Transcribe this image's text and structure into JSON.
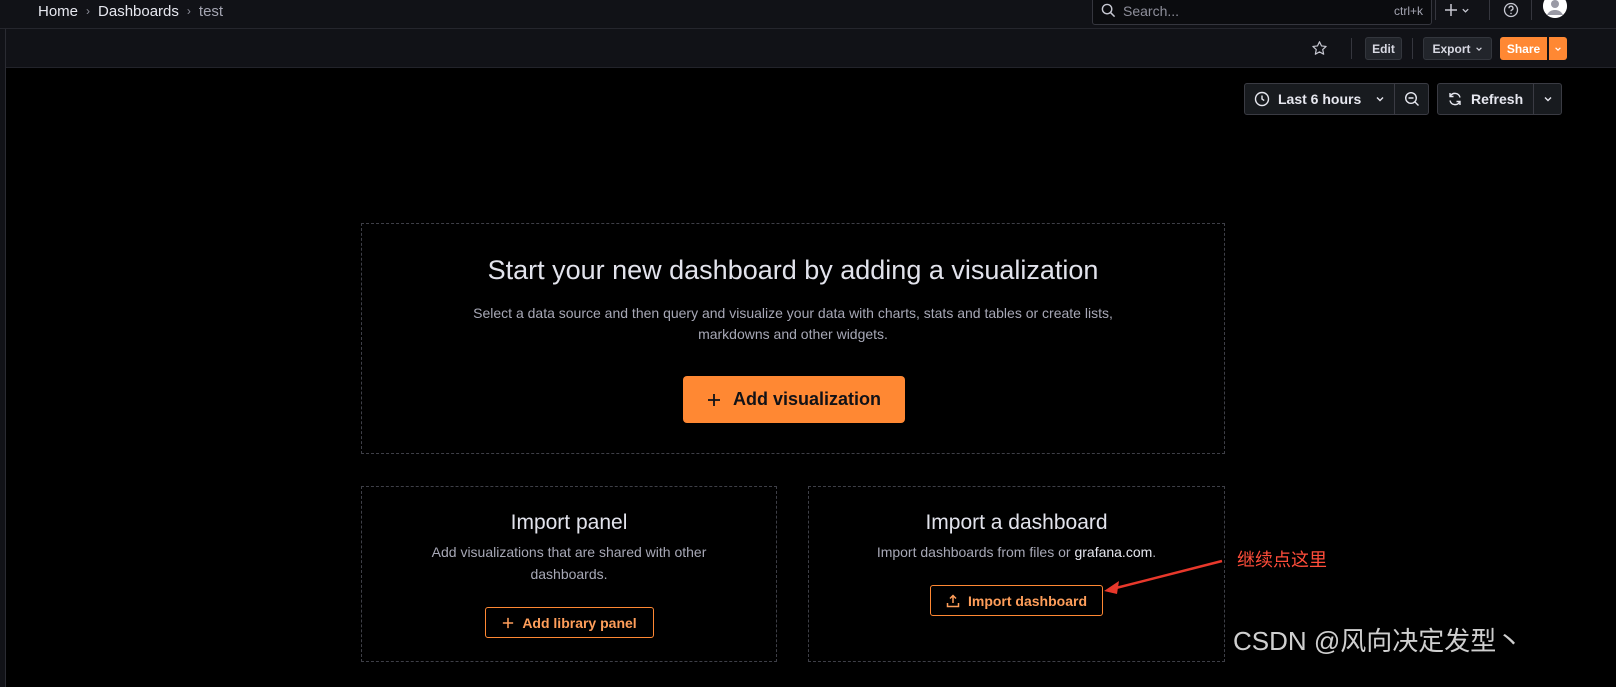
{
  "breadcrumb": {
    "items": [
      "Home",
      "Dashboards",
      "test"
    ]
  },
  "search": {
    "placeholder": "Search...",
    "shortcut": "ctrl+k"
  },
  "toolbar": {
    "edit_label": "Edit",
    "export_label": "Export",
    "share_label": "Share"
  },
  "time_controls": {
    "range_label": "Last 6 hours",
    "refresh_label": "Refresh"
  },
  "empty_state": {
    "title": "Start your new dashboard by adding a visualization",
    "description_line1": "Select a data source and then query and visualize your data with charts, stats and tables or create lists,",
    "description_line2": "markdowns and other widgets.",
    "add_visualization_label": "Add visualization"
  },
  "import_panel": {
    "title": "Import panel",
    "description_line1": "Add visualizations that are shared with other",
    "description_line2": "dashboards.",
    "button_label": "Add library panel"
  },
  "import_dashboard": {
    "title": "Import a dashboard",
    "description_prefix": "Import dashboards from files or",
    "description_link": "grafana.com",
    "description_suffix": ".",
    "button_label": "Import dashboard"
  },
  "annotation": {
    "note": "继续点这里"
  },
  "watermark": {
    "text": "CSDN @风向决定发型丶"
  },
  "colors": {
    "accent": "#ff8833",
    "background": "#000000",
    "annotation": "#ff4d3a"
  },
  "icons": [
    "search-icon",
    "plus-icon",
    "chevron-down-icon",
    "help-icon",
    "avatar",
    "star-icon",
    "clock-icon",
    "zoom-out-icon",
    "refresh-icon",
    "upload-icon"
  ]
}
